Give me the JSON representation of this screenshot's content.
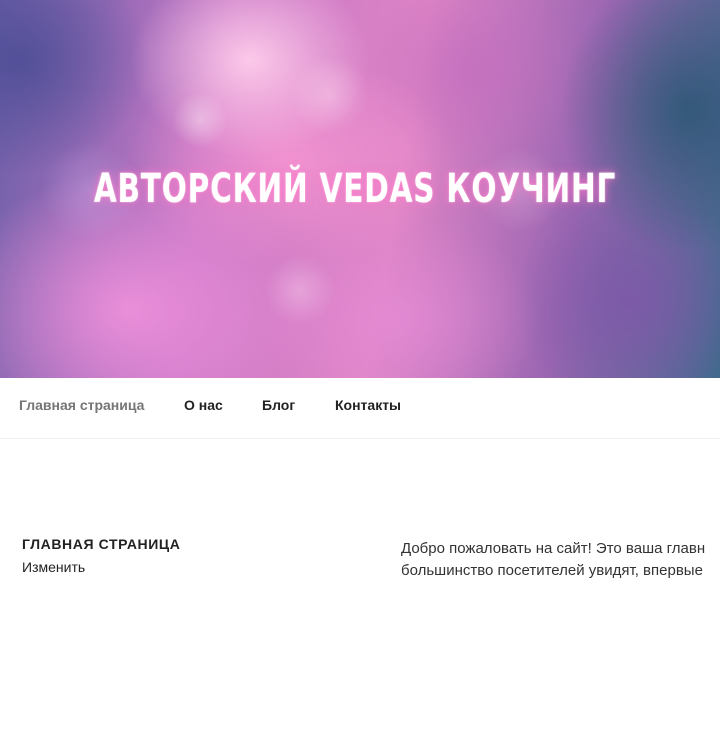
{
  "site": {
    "title": "АВТОРСКИЙ VEDAS КОУЧИНГ"
  },
  "nav": {
    "items": [
      {
        "label": "Главная страница",
        "current": true
      },
      {
        "label": "О нас"
      },
      {
        "label": "Блог"
      },
      {
        "label": "Контакты"
      }
    ]
  },
  "page": {
    "title": "ГЛАВНАЯ СТРАНИЦА",
    "edit_label": "Изменить",
    "content_line1": "Добро пожаловать на сайт! Это ваша главн",
    "content_line2": "большинство посетителей увидят, впервые"
  },
  "colors": {
    "text": "#222222",
    "nav_current": "#767676",
    "hero_pink": "#de84c6",
    "hero_teal": "#3f6a8c"
  }
}
